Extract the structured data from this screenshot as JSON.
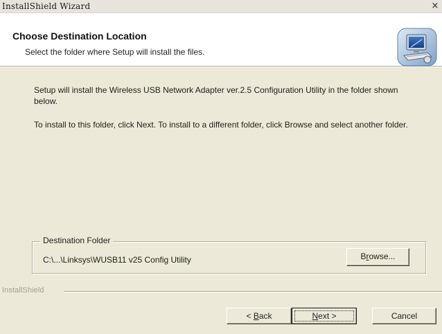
{
  "window": {
    "title": "InstallShield Wizard",
    "close_glyph": "×"
  },
  "header": {
    "title": "Choose Destination Location",
    "subtitle": "Select the folder where Setup will install the files.",
    "icon": "setup-computer-icon"
  },
  "body": {
    "paragraph1": "Setup will install the Wireless USB Network Adapter ver.2.5 Configuration Utility in the folder shown below.",
    "paragraph2": "To install to this folder, click Next. To install to a different folder, click Browse and select another folder."
  },
  "destination": {
    "group_label": "Destination Folder",
    "path": "C:\\...\\Linksys\\WUSB11 v25 Config Utility",
    "browse_prefix": "B",
    "browse_accel": "r",
    "browse_suffix": "owse..."
  },
  "footer": {
    "brand": "InstallShield",
    "back_prefix": "< ",
    "back_accel": "B",
    "back_suffix": "ack",
    "next_accel": "N",
    "next_suffix": "ext >",
    "cancel_label": "Cancel"
  }
}
